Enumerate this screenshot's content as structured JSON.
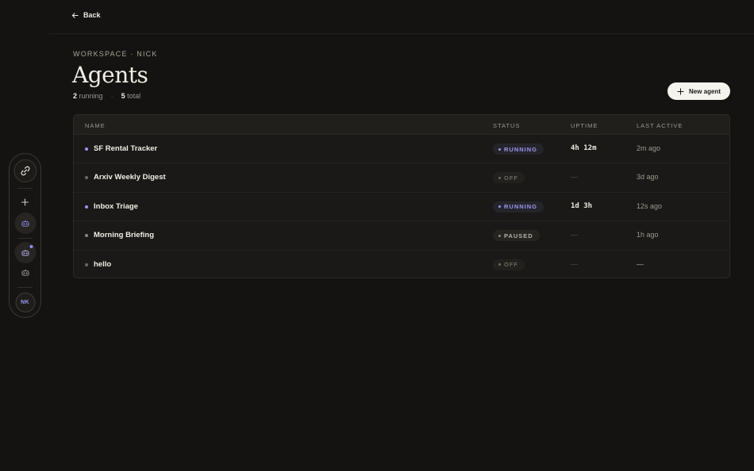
{
  "topbar": {
    "back_label": "Back"
  },
  "rail": {
    "items": [
      {
        "name": "logo",
        "icon": "link-icon"
      },
      {
        "name": "add",
        "icon": "plus-icon"
      },
      {
        "name": "agent-1",
        "icon": "robot-icon",
        "active": true
      },
      {
        "name": "agent-2",
        "icon": "robot-icon",
        "notification": true
      },
      {
        "name": "agent-3",
        "icon": "robot-icon"
      }
    ],
    "avatar_initials": "NK"
  },
  "header": {
    "breadcrumb": "WORKSPACE · NICK",
    "title": "Agents",
    "running_count": "2",
    "running_label": "running",
    "separator": "·",
    "total_count": "5",
    "total_label": "total",
    "new_agent_label": "New agent"
  },
  "table": {
    "columns": [
      "NAME",
      "STATUS",
      "UPTIME",
      "LAST ACTIVE"
    ],
    "rows": [
      {
        "name": "SF Rental Tracker",
        "status": "RUNNING",
        "uptime": "4h 12m",
        "last_active": "2m ago"
      },
      {
        "name": "Arxiv Weekly Digest",
        "status": "OFF",
        "uptime": "—",
        "last_active": "3d ago"
      },
      {
        "name": "Inbox Triage",
        "status": "RUNNING",
        "uptime": "1d 3h",
        "last_active": "12s ago"
      },
      {
        "name": "Morning Briefing",
        "status": "PAUSED",
        "uptime": "—",
        "last_active": "1h ago"
      },
      {
        "name": "hello",
        "status": "OFF",
        "uptime": "—",
        "last_active": "—"
      }
    ]
  },
  "colors": {
    "background": "#141311",
    "accent": "#9a97f0",
    "running": "#9a97f0",
    "off": "#6c6861",
    "paused": "#8a857b"
  }
}
